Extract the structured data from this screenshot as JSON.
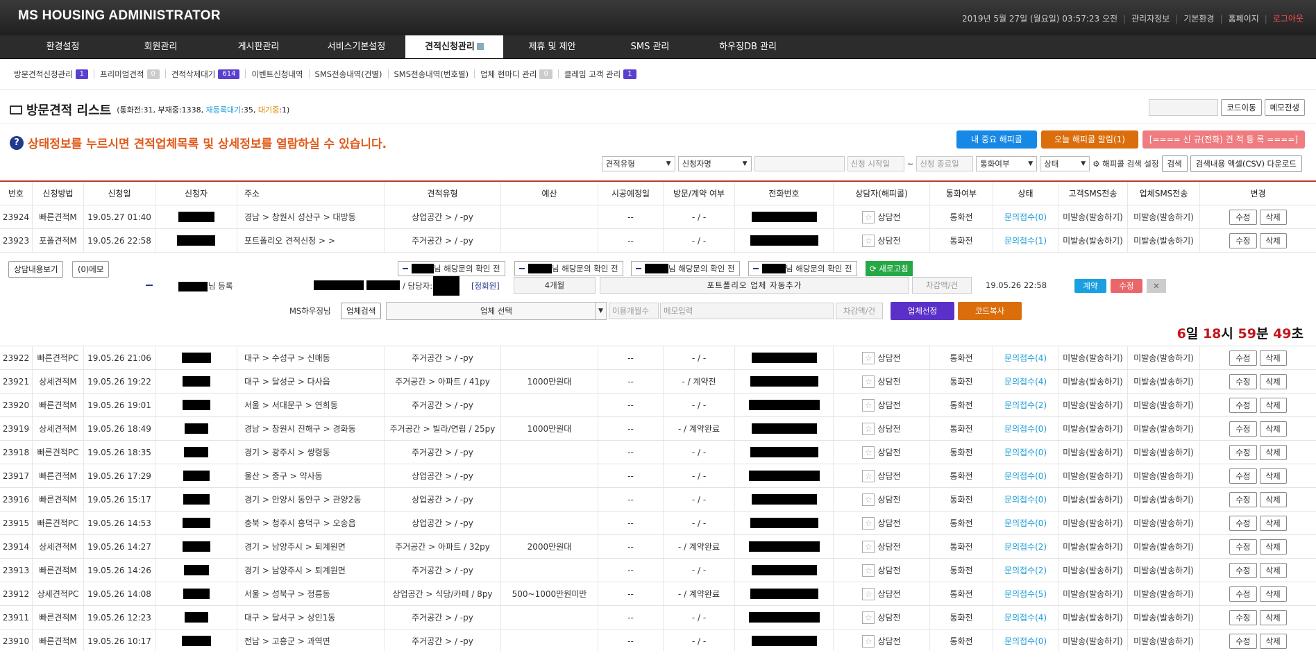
{
  "app": {
    "title": "MS HOUSING ADMINISTRATOR"
  },
  "topbar": {
    "datetime": "2019년 5월 27일 (월요일) 03:57:23 오전",
    "links": [
      "관리자정보",
      "기본환경",
      "홈페이지"
    ],
    "logout": "로그아웃"
  },
  "mainmenu": [
    "환경설정",
    "회원관리",
    "게시판관리",
    "서비스기본설정",
    "견적신청관리",
    "제휴 및 제안",
    "SMS 관리",
    "하우징DB 관리"
  ],
  "submenu": [
    {
      "label": "방문견적신청관리",
      "count": "1",
      "gray": false
    },
    {
      "label": "프리미엄견적",
      "count": "0",
      "gray": true
    },
    {
      "label": "견적삭제대기",
      "count": "614",
      "gray": false
    },
    {
      "label": "이벤트신청내역",
      "count": "",
      "gray": false
    },
    {
      "label": "SMS전송내역(건별)",
      "count": "",
      "gray": false
    },
    {
      "label": "SMS전송내역(번호별)",
      "count": "",
      "gray": false
    },
    {
      "label": "업체 현마디 관리",
      "count": "0",
      "gray": true
    },
    {
      "label": "클레임 고객 관리",
      "count": "1",
      "gray": false
    }
  ],
  "page": {
    "title": "방문견적 리스트",
    "stats_a": "(통화전:31, 부재중:1338, ",
    "stats_b": "재등록대기",
    "stats_c": ":35, ",
    "stats_d": "대기중",
    "stats_e": ":1)",
    "code_move": "코드이동",
    "memo_all": "메모전생"
  },
  "notice": "상태정보를 누르시면 견적업체목록 및 상세정보를 열람하실 수 있습니다.",
  "actions": {
    "important": "내 중요 해피콜",
    "today_alarm": "오늘 해피콜 알림(1)",
    "new_register": "[==== 신 규(전화) 견 적 등 록 ====]"
  },
  "filters": {
    "type": "견적유형",
    "name": "신청자명",
    "start_ph": "신청 시작일",
    "end_ph": "신청 종료일",
    "tilde": "~",
    "call": "통화여부",
    "state": "상태",
    "happy": "⚙ 해피콜 검색 설정",
    "search": "검색",
    "excel": "검색내용 엑셀(CSV) 다운로드"
  },
  "columns": [
    "번호",
    "신청방법",
    "신청일",
    "신청자",
    "주소",
    "견적유형",
    "예산",
    "시공예정일",
    "방문/계약 여부",
    "전화번호",
    "상담자(해피콜)",
    "통화여부",
    "상태",
    "고객SMS전송",
    "업체SMS전송",
    "변경"
  ],
  "rows_top": [
    {
      "no": "23924",
      "method": "빠른견적M",
      "date": "19.05.27 01:40",
      "addr": "경남 > 창원시 성산구 > 대방동",
      "type": "상업공간 > / -py",
      "budget": "",
      "sched": "--",
      "visit": "- / -",
      "counsel": "상담전",
      "call": "통화전",
      "status": "문의접수(0)",
      "csms": "미발송(발송하기)",
      "bsms": "미발송(발송하기)",
      "w": 52
    },
    {
      "no": "23923",
      "method": "포폴견적M",
      "date": "19.05.26 22:58",
      "addr": "포트폴리오 견적신청 > >",
      "type": "주거공간 > / -py",
      "budget": "",
      "sched": "--",
      "visit": "- / -",
      "counsel": "상담전",
      "call": "통화전",
      "status": "문의접수(1)",
      "csms": "미발송(발송하기)",
      "bsms": "미발송(발송하기)",
      "w": 55
    }
  ],
  "detail": {
    "view_btn": "상담내용보기",
    "memo_btn": "(0)메모",
    "check_label": "님 해당문의 확인 전",
    "refresh": "새로고침",
    "registered": "님 등록",
    "manager": "/ 담당자:",
    "member": "[정회원]",
    "period": "4개월",
    "auto_add": "포트폴리오 업체 자동추가",
    "diff_ph": "차감액/건",
    "reg_date": "19.05.26 22:58",
    "contract": "계약",
    "edit": "수정",
    "ms_label": "MS하우징님",
    "vendor_search": "업체검색",
    "vendor_select": "업체 선택",
    "used_ph": "이용개월수",
    "memo_ph": "메모입력",
    "diff_ph2": "차감액/건",
    "vendor_choose": "업체선정",
    "code_copy": "코드복사",
    "t_days": "6",
    "t_days_u": "일",
    "t_hours": "18",
    "t_hours_u": "시",
    "t_min": "59",
    "t_min_u": "분",
    "t_sec": "49",
    "t_sec_u": "초"
  },
  "rows": [
    {
      "no": "23922",
      "method": "빠른견적PC",
      "date": "19.05.26 21:06",
      "addr": "대구 > 수성구 > 신매동",
      "type": "주거공간 > / -py",
      "budget": "",
      "sched": "--",
      "visit": "- / -",
      "counsel": "상담전",
      "call": "통화전",
      "status": "문의접수(4)",
      "csms": "미발송(발송하기)",
      "bsms": "미발송(발송하기)",
      "w": 42
    },
    {
      "no": "23921",
      "method": "상세견적M",
      "date": "19.05.26 19:22",
      "addr": "대구 > 달성군 > 다사읍",
      "type": "주거공간 > 아파트 / 41py",
      "budget": "1000만원대",
      "sched": "--",
      "visit": "- / 계약전",
      "counsel": "상담전",
      "call": "통화전",
      "status": "문의접수(4)",
      "csms": "미발송(발송하기)",
      "bsms": "미발송(발송하기)",
      "w": 40
    },
    {
      "no": "23920",
      "method": "빠른견적M",
      "date": "19.05.26 19:01",
      "addr": "서울 > 서대문구 > 연희동",
      "type": "주거공간 > / -py",
      "budget": "",
      "sched": "--",
      "visit": "- / -",
      "counsel": "상담전",
      "call": "통화전",
      "status": "문의접수(2)",
      "csms": "미발송(발송하기)",
      "bsms": "미발송(발송하기)",
      "w": 40
    },
    {
      "no": "23919",
      "method": "상세견적M",
      "date": "19.05.26 18:49",
      "addr": "경남 > 창원시 진해구 > 경화동",
      "type": "주거공간 > 빌라/연립 / 25py",
      "budget": "1000만원대",
      "sched": "--",
      "visit": "- / 계약완료",
      "counsel": "상담전",
      "call": "통화전",
      "status": "문의접수(0)",
      "csms": "미발송(발송하기)",
      "bsms": "미발송(발송하기)",
      "w": 34
    },
    {
      "no": "23918",
      "method": "빠른견적PC",
      "date": "19.05.26 18:35",
      "addr": "경기 > 광주시 > 쌍령동",
      "type": "주거공간 > / -py",
      "budget": "",
      "sched": "--",
      "visit": "- / -",
      "counsel": "상담전",
      "call": "통화전",
      "status": "문의접수(0)",
      "csms": "미발송(발송하기)",
      "bsms": "미발송(발송하기)",
      "w": 35
    },
    {
      "no": "23917",
      "method": "빠른견적M",
      "date": "19.05.26 17:29",
      "addr": "울산 > 중구 > 약사동",
      "type": "상업공간 > / -py",
      "budget": "",
      "sched": "--",
      "visit": "- / -",
      "counsel": "상담전",
      "call": "통화전",
      "status": "문의접수(0)",
      "csms": "미발송(발송하기)",
      "bsms": "미발송(발송하기)",
      "w": 38
    },
    {
      "no": "23916",
      "method": "빠른견적M",
      "date": "19.05.26 15:17",
      "addr": "경기 > 안양시 동안구 > 관양2동",
      "type": "상업공간 > / -py",
      "budget": "",
      "sched": "--",
      "visit": "- / -",
      "counsel": "상담전",
      "call": "통화전",
      "status": "문의접수(0)",
      "csms": "미발송(발송하기)",
      "bsms": "미발송(발송하기)",
      "w": 38
    },
    {
      "no": "23915",
      "method": "빠른견적PC",
      "date": "19.05.26 14:53",
      "addr": "충북 > 청주시 흥덕구 > 오송읍",
      "type": "상업공간 > / -py",
      "budget": "",
      "sched": "--",
      "visit": "- / -",
      "counsel": "상담전",
      "call": "통화전",
      "status": "문의접수(0)",
      "csms": "미발송(발송하기)",
      "bsms": "미발송(발송하기)",
      "w": 40
    },
    {
      "no": "23914",
      "method": "상세견적M",
      "date": "19.05.26 14:27",
      "addr": "경기 > 남양주시 > 퇴계원면",
      "type": "주거공간 > 아파트 / 32py",
      "budget": "2000만원대",
      "sched": "--",
      "visit": "- / 계약완료",
      "counsel": "상담전",
      "call": "통화전",
      "status": "문의접수(2)",
      "csms": "미발송(발송하기)",
      "bsms": "미발송(발송하기)",
      "w": 40
    },
    {
      "no": "23913",
      "method": "빠른견적M",
      "date": "19.05.26 14:26",
      "addr": "경기 > 남양주시 > 퇴계원면",
      "type": "주거공간 > / -py",
      "budget": "",
      "sched": "--",
      "visit": "- / -",
      "counsel": "상담전",
      "call": "통화전",
      "status": "문의접수(2)",
      "csms": "미발송(발송하기)",
      "bsms": "미발송(발송하기)",
      "w": 36
    },
    {
      "no": "23912",
      "method": "상세견적PC",
      "date": "19.05.26 14:08",
      "addr": "서울 > 성북구 > 정릉동",
      "type": "상업공간 > 식당/카페 / 8py",
      "budget": "500~1000만원미만",
      "sched": "--",
      "visit": "- / 계약완료",
      "counsel": "상담전",
      "call": "통화전",
      "status": "문의접수(5)",
      "csms": "미발송(발송하기)",
      "bsms": "미발송(발송하기)",
      "w": 38
    },
    {
      "no": "23911",
      "method": "빠른견적M",
      "date": "19.05.26 12:23",
      "addr": "대구 > 달서구 > 상인1동",
      "type": "주거공간 > / -py",
      "budget": "",
      "sched": "--",
      "visit": "- / -",
      "counsel": "상담전",
      "call": "통화전",
      "status": "문의접수(4)",
      "csms": "미발송(발송하기)",
      "bsms": "미발송(발송하기)",
      "w": 34
    },
    {
      "no": "23910",
      "method": "빠른견적M",
      "date": "19.05.26 10:17",
      "addr": "전남 > 고흥군 > 과역면",
      "type": "주거공간 > / -py",
      "budget": "",
      "sched": "--",
      "visit": "- / -",
      "counsel": "상담전",
      "call": "통화전",
      "status": "문의접수(0)",
      "csms": "미발송(발송하기)",
      "bsms": "미발송(발송하기)",
      "w": 42
    }
  ],
  "row_btns": {
    "edit": "수정",
    "delete": "삭제"
  }
}
